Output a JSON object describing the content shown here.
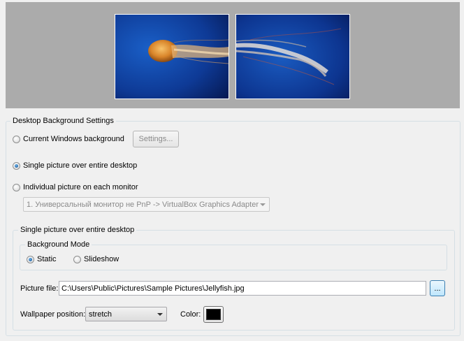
{
  "preview": {
    "monitor_left": "Monitor 1 preview",
    "monitor_right": "Monitor 2 preview"
  },
  "settings_group": {
    "title": "Desktop Background Settings",
    "options": {
      "current": "Current Windows background",
      "single": "Single picture over entire desktop",
      "individual": "Individual picture on each monitor"
    },
    "selected": "single",
    "settings_button": "Settings...",
    "monitor_select": "1. Универсальный монитор не PnP -> VirtualBox Graphics Adapter"
  },
  "single_group": {
    "title": "Single picture over entire desktop",
    "mode_group": {
      "title": "Background Mode",
      "static": "Static",
      "slideshow": "Slideshow",
      "selected": "static"
    },
    "picture_file_label": "Picture file:",
    "picture_file_value": "C:\\Users\\Public\\Pictures\\Sample Pictures\\Jellyfish.jpg",
    "browse_button": "...",
    "wallpaper_position_label": "Wallpaper position:",
    "wallpaper_position_value": "stretch",
    "color_label": "Color:",
    "color_value": "#000000"
  },
  "icons": {
    "radio": "radio-button",
    "dropdown": "chevron-down-icon"
  }
}
